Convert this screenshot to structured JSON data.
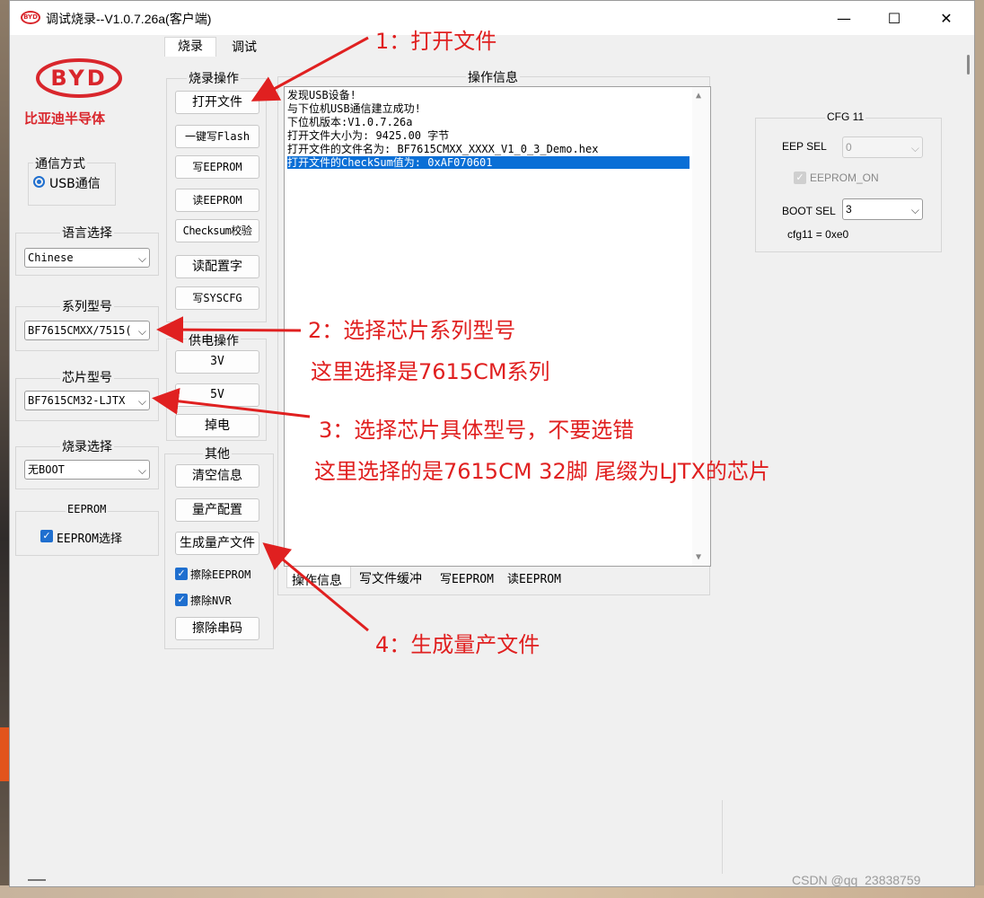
{
  "window": {
    "title": "调试烧录--V1.0.7.26a(客户端)",
    "app_icon_text": "BYD",
    "minimize": "—",
    "maximize": "☐",
    "close": "✕"
  },
  "logo": {
    "brand": "BYD",
    "subtitle": "比亚迪半导体"
  },
  "tabs": [
    "烧录",
    "调试"
  ],
  "comm": {
    "label": "通信方式",
    "option": "USB通信"
  },
  "language": {
    "label": "语言选择",
    "value": "Chinese"
  },
  "series": {
    "label": "系列型号",
    "value": "BF7615CMXX/7515("
  },
  "chip": {
    "label": "芯片型号",
    "value": "BF7615CM32-LJTX"
  },
  "burn_select": {
    "label": "烧录选择",
    "value": "无BOOT"
  },
  "eeprom": {
    "label": "EEPROM",
    "checkbox": "EEPROM选择"
  },
  "burn_ops": {
    "label": "烧录操作",
    "buttons": [
      "打开文件",
      "一键写Flash",
      "写EEPROM",
      "读EEPROM",
      "Checksum校验",
      "读配置字",
      "写SYSCFG"
    ]
  },
  "power_ops": {
    "label": "供电操作",
    "buttons": [
      "3V",
      "5V",
      "掉电"
    ]
  },
  "other": {
    "label": "其他",
    "buttons": [
      "清空信息",
      "量产配置",
      "生成量产文件"
    ],
    "checks": [
      "擦除EEPROM",
      "擦除NVR"
    ],
    "erase_serial": "擦除串码"
  },
  "log": {
    "label": "操作信息",
    "lines": [
      "发现USB设备!",
      "与下位机USB通信建立成功!",
      "下位机版本:V1.0.7.26a",
      "打开文件大小为: 9425.00 字节",
      "打开文件的文件名为: BF7615CMXX_XXXX_V1_0_3_Demo.hex",
      "打开文件的CheckSum值为: 0xAF070601"
    ],
    "bottom_tabs": [
      "操作信息",
      "写文件缓冲",
      "写EEPROM",
      "读EEPROM"
    ]
  },
  "cfg": {
    "title": "CFG 11",
    "eep_sel_label": "EEP SEL",
    "eep_sel_value": "0",
    "eeprom_on": "EEPROM_ON",
    "boot_sel_label": "BOOT SEL",
    "boot_sel_value": "3",
    "cfg11": "cfg11 = 0xe0"
  },
  "annotations": {
    "a1": "1：打开文件",
    "a2_line1": "2：选择芯片系列型号",
    "a2_line2": "这里选择是7615CM系列",
    "a3_line1": "3：选择芯片具体型号，不要选错",
    "a3_line2": "这里选择的是7615CM 32脚 尾缀为LJTX的芯片",
    "a4": "4：生成量产文件",
    "color": "#e02020"
  },
  "watermark": "CSDN @qq_23838759"
}
